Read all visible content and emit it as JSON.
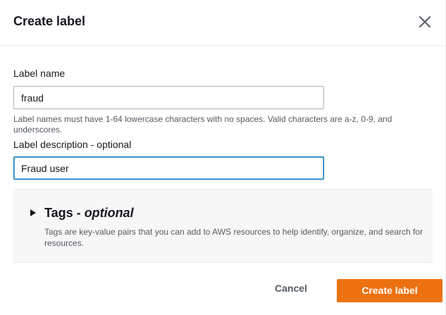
{
  "dialog": {
    "title": "Create label"
  },
  "label_name": {
    "label": "Label name",
    "value": "fraud",
    "hint": "Label names must have 1-64 lowercase characters with no spaces. Valid characters are a-z, 0-9, and underscores."
  },
  "label_description": {
    "label": "Label description - optional",
    "value": "Fraud user"
  },
  "tags": {
    "title": "Tags -",
    "optional": "optional",
    "description": "Tags are key-value pairs that you can add to AWS resources to help identify, organize, and search for resources.",
    "expanded": false
  },
  "footer": {
    "cancel_label": "Cancel",
    "submit_label": "Create label"
  },
  "colors": {
    "primary": "#ec7211",
    "focus": "#0073bb",
    "text": "#16191f",
    "muted": "#545b64"
  },
  "icons": {
    "close": "close-icon",
    "caret": "caret-right-icon"
  }
}
